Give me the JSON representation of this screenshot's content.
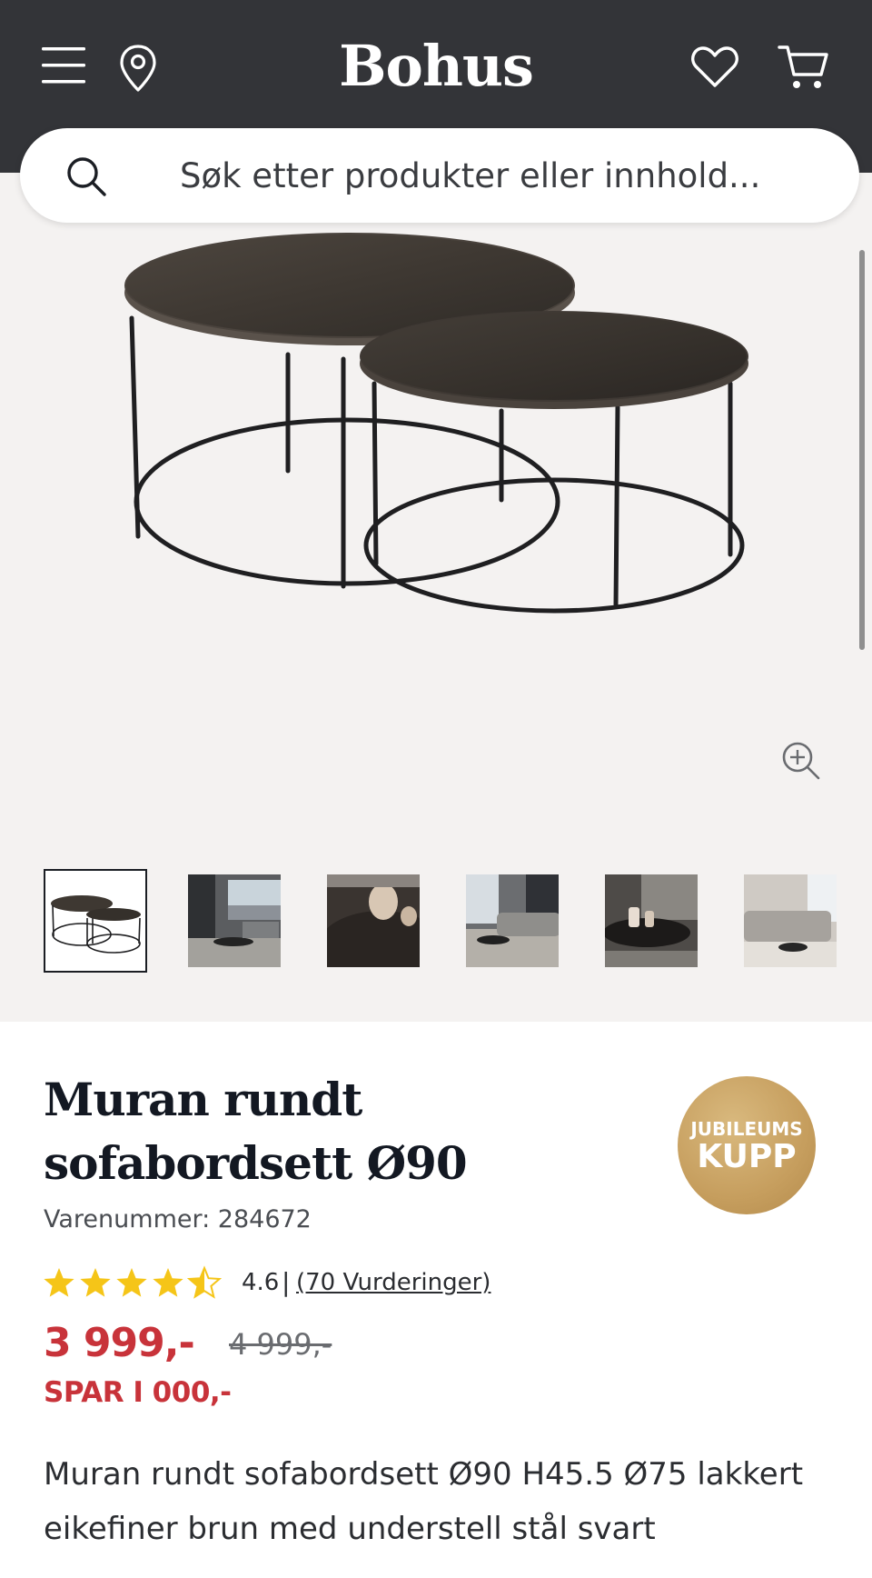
{
  "header": {
    "logo": "Bohus",
    "menu_icon": "hamburger-menu-icon",
    "location_icon": "map-pin-icon",
    "wishlist_icon": "heart-icon",
    "cart_icon": "shopping-cart-icon",
    "background_color": "#333438"
  },
  "search": {
    "placeholder": "Søk etter produkter eller innhold...",
    "icon": "search-icon"
  },
  "gallery": {
    "main_image": "nesting round coffee table set",
    "zoom_icon": "zoom-in-icon",
    "thumbnails": [
      {
        "alt": "tables on white"
      },
      {
        "alt": "living room with tables"
      },
      {
        "alt": "table top close-up with vases"
      },
      {
        "alt": "living room sofa set"
      },
      {
        "alt": "table with candles"
      },
      {
        "alt": "corner sofa living room"
      }
    ]
  },
  "product": {
    "title_line1": "Muran rundt",
    "title_line2": "sofabordsett Ø90",
    "sku": "Varenummer: 284672",
    "badge_line1": "JUBILEUMS",
    "badge_line2": "KUPP",
    "rating": 4.6,
    "rating_label": "4.6",
    "rating_separator": "|",
    "reviews_label": "(70 Vurderinger)",
    "price": "3 999,-",
    "old_price": "4 999,-",
    "savings": "SPAR I 000,-",
    "description": "Muran rundt sofabordsett Ø90 H45.5 Ø75 lakkert eikefiner brun med understell stål svart"
  },
  "colors": {
    "accent_red": "#c8333a",
    "badge_gold": "#c69e5e",
    "star_yellow": "#f5c518"
  }
}
